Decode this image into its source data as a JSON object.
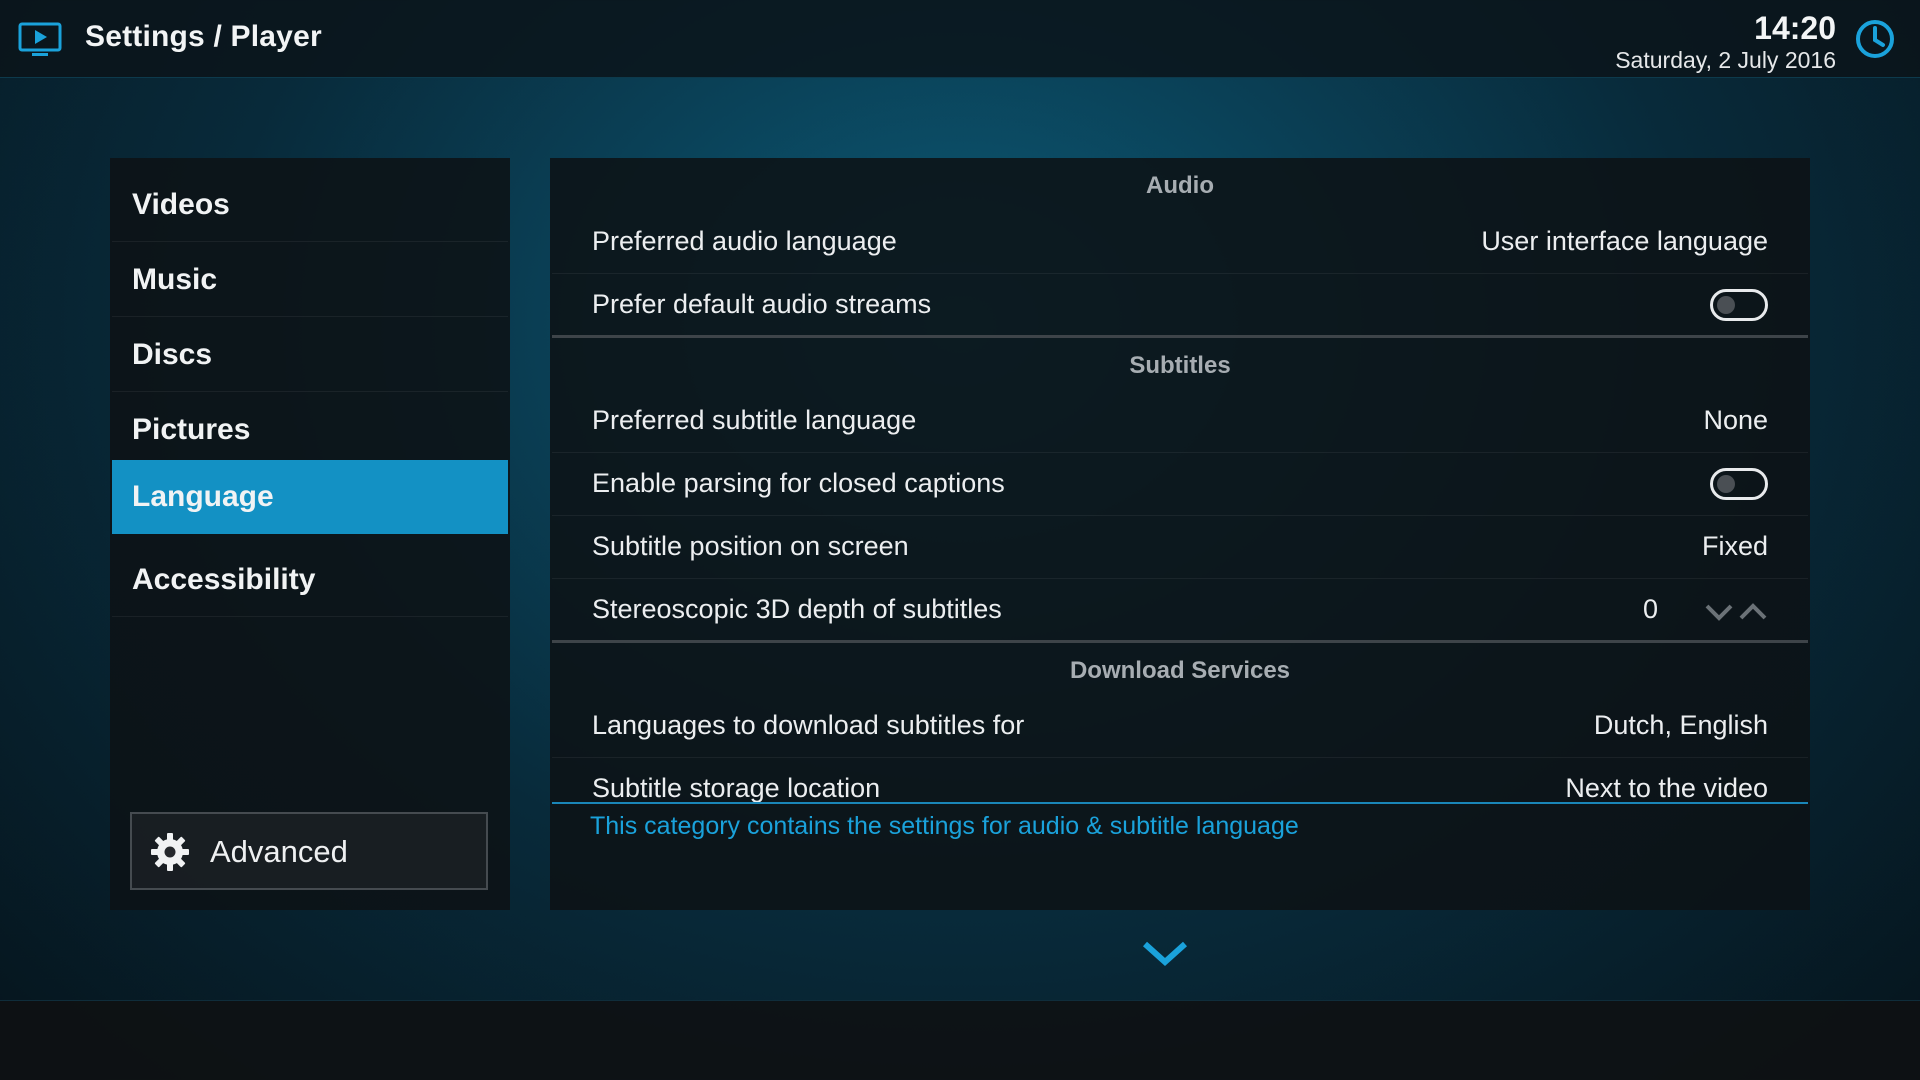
{
  "header": {
    "title": "Settings / Player",
    "time": "14:20",
    "date": "Saturday, 2 July 2016"
  },
  "sidebar": {
    "items": [
      {
        "label": "Videos",
        "active": false
      },
      {
        "label": "Music",
        "active": false
      },
      {
        "label": "Discs",
        "active": false
      },
      {
        "label": "Pictures",
        "active": false
      },
      {
        "label": "Language",
        "active": true
      },
      {
        "label": "Accessibility",
        "active": false
      }
    ],
    "advanced_label": "Advanced"
  },
  "sections": {
    "audio": {
      "header": "Audio",
      "preferred_audio_language": {
        "label": "Preferred audio language",
        "value": "User interface language"
      },
      "prefer_default_audio_streams": {
        "label": "Prefer default audio streams",
        "enabled": false
      }
    },
    "subtitles": {
      "header": "Subtitles",
      "preferred_subtitle_language": {
        "label": "Preferred subtitle language",
        "value": "None"
      },
      "enable_parsing_closed_captions": {
        "label": "Enable parsing for closed captions",
        "enabled": false
      },
      "subtitle_position": {
        "label": "Subtitle position on screen",
        "value": "Fixed"
      },
      "stereoscopic_depth": {
        "label": "Stereoscopic 3D depth of subtitles",
        "value": "0"
      }
    },
    "download_services": {
      "header": "Download Services",
      "languages_to_download": {
        "label": "Languages to download subtitles for",
        "value": "Dutch, English"
      },
      "storage_location": {
        "label": "Subtitle storage location",
        "value": "Next to the video"
      }
    }
  },
  "description": "This category contains the settings for audio & subtitle language",
  "colors": {
    "accent": "#1391c4",
    "description_text": "#1aa2db"
  },
  "icons": {
    "app": "tv-icon",
    "clock": "clock-icon",
    "advanced": "gear-icon",
    "scroll": "chevron-down-icon"
  }
}
